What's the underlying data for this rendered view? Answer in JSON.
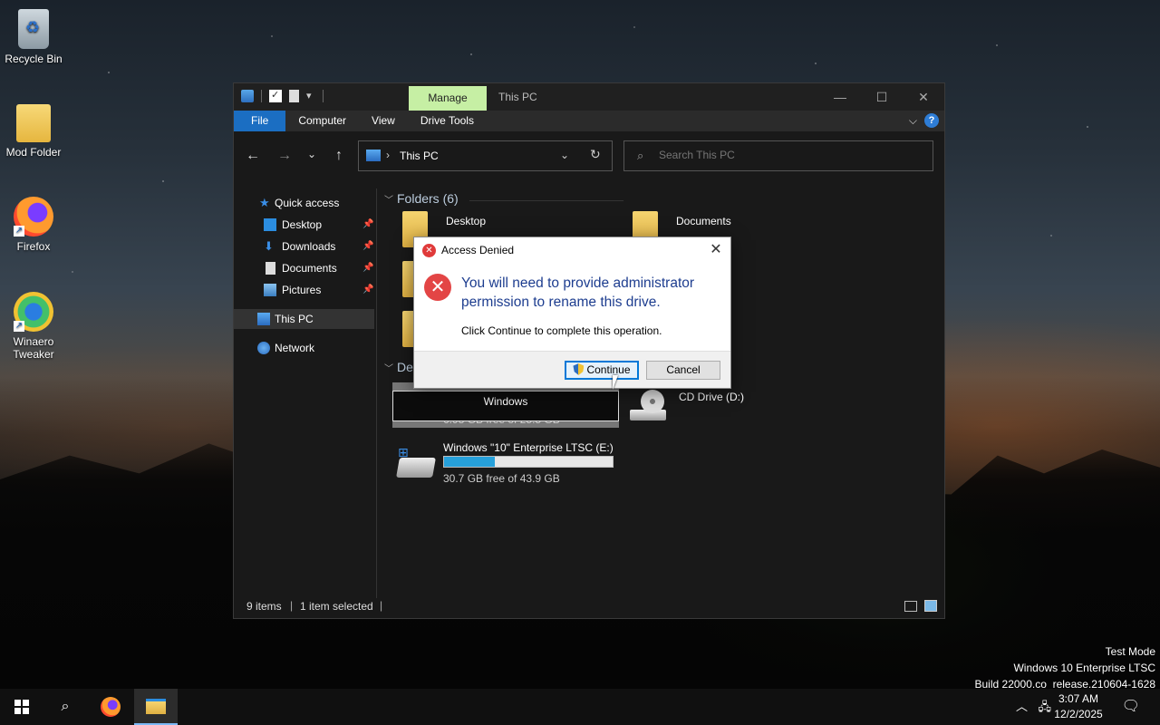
{
  "desktop": {
    "icons": [
      {
        "label": "Recycle Bin"
      },
      {
        "label": "Mod Folder"
      },
      {
        "label": "Firefox"
      },
      {
        "label": "Winaero Tweaker"
      }
    ]
  },
  "window": {
    "manage_tab": "Manage",
    "title": "This PC",
    "ribbon_tabs": [
      "File",
      "Computer",
      "View",
      "Drive Tools"
    ],
    "address": {
      "crumb": "This PC"
    },
    "search": {
      "placeholder": "Search This PC"
    },
    "sidebar": [
      {
        "label": "Quick access",
        "icon": "star-icon"
      },
      {
        "label": "Desktop",
        "icon": "desktop-folder-icon",
        "pinned": true
      },
      {
        "label": "Downloads",
        "icon": "download-icon",
        "pinned": true
      },
      {
        "label": "Documents",
        "icon": "document-icon",
        "pinned": true
      },
      {
        "label": "Pictures",
        "icon": "pictures-icon",
        "pinned": true
      },
      {
        "label": "This PC",
        "icon": "computer-icon",
        "selected": true
      },
      {
        "label": "Network",
        "icon": "network-icon"
      }
    ],
    "folders_header": "Folders (6)",
    "folders": [
      {
        "name": "Desktop"
      },
      {
        "name": "Documents"
      }
    ],
    "devices_header_partial": "De",
    "drives": [
      {
        "name": "Windows",
        "free": "6.98 GB free of 25.5 GB",
        "used_fraction": 0.73
      },
      {
        "name": "Windows \"10\" Enterprise LTSC (E:)",
        "free": "30.7 GB free of 43.9 GB",
        "used_fraction": 0.3
      },
      {
        "name": "CD Drive (D:)"
      }
    ],
    "rename_value": "Windows",
    "status": {
      "items": "9 items",
      "selected": "1 item selected"
    }
  },
  "dialog": {
    "title": "Access Denied",
    "main_text": "You will need to provide administrator permission to rename this drive.",
    "sub_text": "Click Continue to complete this operation.",
    "continue_label": "Continue",
    "cancel_label": "Cancel"
  },
  "watermark": {
    "line1": "Test Mode",
    "line2": "Windows 10 Enterprise LTSC",
    "line3": "Build 22000.co_release.210604-1628"
  },
  "taskbar": {
    "time": "3:07 AM",
    "date": "12/2/2025"
  }
}
